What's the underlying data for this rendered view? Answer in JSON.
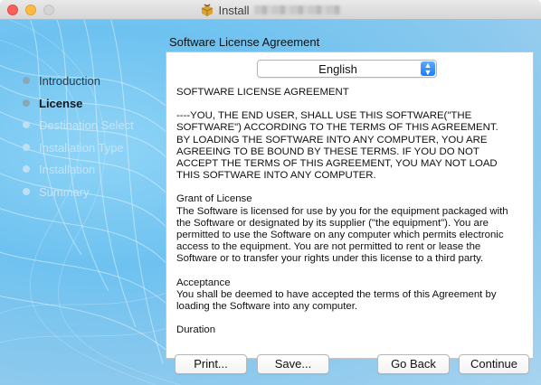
{
  "window": {
    "title_prefix": "Install",
    "title_icon": "package-icon"
  },
  "sidebar": {
    "steps": [
      {
        "label": "Introduction",
        "state": "done"
      },
      {
        "label": "License",
        "state": "active"
      },
      {
        "label": "Destination Select",
        "state": "future"
      },
      {
        "label": "Installation Type",
        "state": "future"
      },
      {
        "label": "Installation",
        "state": "future"
      },
      {
        "label": "Summary",
        "state": "future"
      }
    ]
  },
  "main": {
    "pane_title": "Software License Agreement",
    "language": {
      "selected": "English"
    },
    "license": {
      "heading": "SOFTWARE LICENSE AGREEMENT",
      "intro": "----YOU, THE END USER, SHALL USE THIS SOFTWARE(\"THE\nSOFTWARE\") ACCORDING TO THE TERMS OF THIS AGREEMENT.\nBY LOADING THE SOFTWARE INTO ANY COMPUTER, YOU ARE\nAGREEING TO BE BOUND BY THESE TERMS. IF YOU DO NOT\nACCEPT THE TERMS OF THIS AGREEMENT, YOU MAY NOT LOAD\nTHIS SOFTWARE INTO ANY COMPUTER.",
      "grant": "Grant of License\nThe Software is licensed for use by you for the equipment packaged with\nthe Software or designated by its supplier (\"the equipment\"). You are\npermitted to use the Software on any computer which permits electronic\naccess to the equipment. You are not permitted to rent or lease the\nSoftware or to transfer your rights under this license to a third party.",
      "acceptance": "Acceptance\nYou shall be deemed to have accepted the terms of this Agreement by\nloading the Software into any computer.",
      "cut_off": "Duration"
    }
  },
  "buttons": {
    "print": "Print...",
    "save": "Save...",
    "go_back": "Go Back",
    "continue": "Continue"
  },
  "colors": {
    "close": "#fc605b",
    "minimize": "#fdbc40",
    "select_accent": "#1a7dfa"
  }
}
